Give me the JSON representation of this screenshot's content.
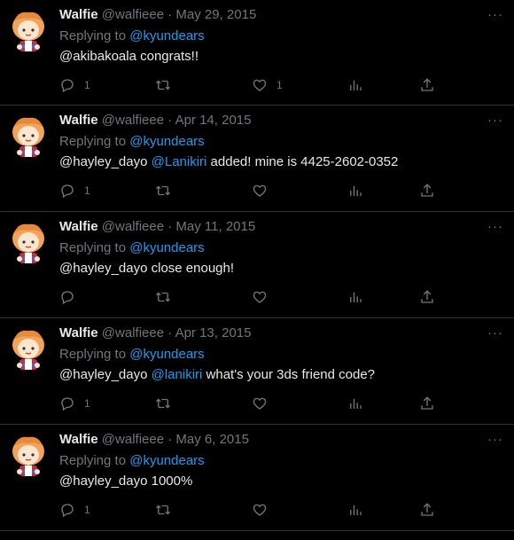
{
  "tweets": [
    {
      "name": "Walfie",
      "handle": "@walfieee",
      "dot": "·",
      "date": "May 29, 2015",
      "replying_prefix": "Replying to",
      "replying_to": "@kyundears",
      "text_parts": [
        {
          "t": "@akibakoala congrats!!",
          "link": false
        }
      ],
      "reply_count": "1",
      "retweet_count": "",
      "like_count": "1"
    },
    {
      "name": "Walfie",
      "handle": "@walfieee",
      "dot": "·",
      "date": "Apr 14, 2015",
      "replying_prefix": "Replying to",
      "replying_to": "@kyundears",
      "text_parts": [
        {
          "t": "@hayley_dayo ",
          "link": false
        },
        {
          "t": "@Lanikiri",
          "link": true
        },
        {
          "t": " added! mine is 4425-2602-0352",
          "link": false
        }
      ],
      "reply_count": "1",
      "retweet_count": "",
      "like_count": ""
    },
    {
      "name": "Walfie",
      "handle": "@walfieee",
      "dot": "·",
      "date": "May 11, 2015",
      "replying_prefix": "Replying to",
      "replying_to": "@kyundears",
      "text_parts": [
        {
          "t": "@hayley_dayo close enough!",
          "link": false
        }
      ],
      "reply_count": "",
      "retweet_count": "",
      "like_count": ""
    },
    {
      "name": "Walfie",
      "handle": "@walfieee",
      "dot": "·",
      "date": "Apr 13, 2015",
      "replying_prefix": "Replying to",
      "replying_to": "@kyundears",
      "text_parts": [
        {
          "t": "@hayley_dayo ",
          "link": false
        },
        {
          "t": "@lanikiri",
          "link": true
        },
        {
          "t": " what's your 3ds friend code?",
          "link": false
        }
      ],
      "reply_count": "1",
      "retweet_count": "",
      "like_count": ""
    },
    {
      "name": "Walfie",
      "handle": "@walfieee",
      "dot": "·",
      "date": "May 6, 2015",
      "replying_prefix": "Replying to",
      "replying_to": "@kyundears",
      "text_parts": [
        {
          "t": "@hayley_dayo 1000%",
          "link": false
        }
      ],
      "reply_count": "1",
      "retweet_count": "",
      "like_count": ""
    }
  ],
  "more_label": "···",
  "colors": {
    "background": "#000000",
    "text": "#e7e9ea",
    "muted": "#71767b",
    "link": "#1d9bf0",
    "divider": "#2f3336"
  },
  "icons": {
    "reply": "reply-icon",
    "retweet": "retweet-icon",
    "like": "heart-icon",
    "views": "views-icon",
    "share": "share-icon",
    "more": "more-icon",
    "avatar": "avatar"
  }
}
